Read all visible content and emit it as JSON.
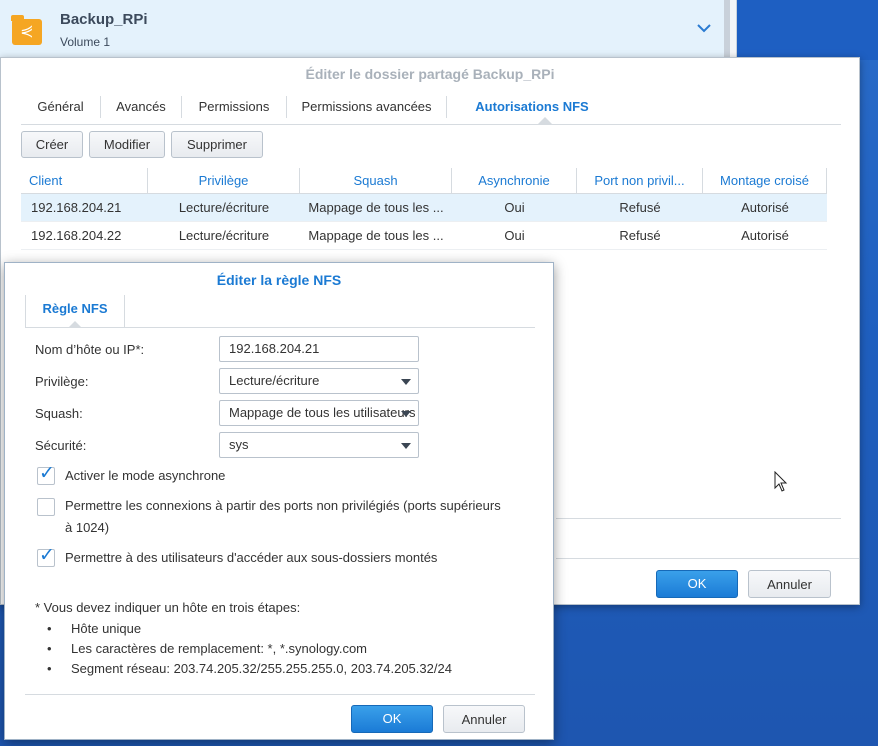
{
  "share": {
    "name": "Backup_RPi",
    "volume": "Volume 1"
  },
  "main_dialog": {
    "title": "Éditer le dossier partagé Backup_RPi",
    "tabs": [
      {
        "label": "Général"
      },
      {
        "label": "Avancés"
      },
      {
        "label": "Permissions"
      },
      {
        "label": "Permissions avancées"
      },
      {
        "label": "Autorisations NFS"
      }
    ],
    "toolbar": {
      "create": "Créer",
      "modify": "Modifier",
      "delete": "Supprimer"
    },
    "columns": [
      "Client",
      "Privilège",
      "Squash",
      "Asynchronie",
      "Port non privil...",
      "Montage croisé"
    ],
    "rows": [
      {
        "client": "192.168.204.21",
        "privilege": "Lecture/écriture",
        "squash": "Mappage de tous les ...",
        "async": "Oui",
        "port": "Refusé",
        "cross": "Autorisé"
      },
      {
        "client": "192.168.204.22",
        "privilege": "Lecture/écriture",
        "squash": "Mappage de tous les ...",
        "async": "Oui",
        "port": "Refusé",
        "cross": "Autorisé"
      }
    ],
    "ok": "OK",
    "cancel": "Annuler"
  },
  "nfs_dialog": {
    "title": "Éditer la règle NFS",
    "tab": "Règle NFS",
    "host_label": "Nom d’hôte ou IP*:",
    "host_value": "192.168.204.21",
    "privilege_label": "Privilège:",
    "privilege_value": "Lecture/écriture",
    "squash_label": "Squash:",
    "squash_value": "Mappage de tous les utilisateurs",
    "security_label": "Sécurité:",
    "security_value": "sys",
    "cb_async": "Activer le mode asynchrone",
    "cb_ports_line1": "Permettre les connexions à partir des ports non privilégiés (ports supérieurs",
    "cb_ports_line2": "à 1024)",
    "cb_subfolders": "Permettre à des utilisateurs d'accéder aux sous-dossiers montés",
    "note": "* Vous devez indiquer un hôte en trois étapes:",
    "bullets": [
      "Hôte unique",
      "Les caractères de remplacement: *, *.synology.com",
      "Segment réseau: 203.74.205.32/255.255.255.0, 203.74.205.32/24"
    ],
    "ok": "OK",
    "cancel": "Annuler"
  }
}
